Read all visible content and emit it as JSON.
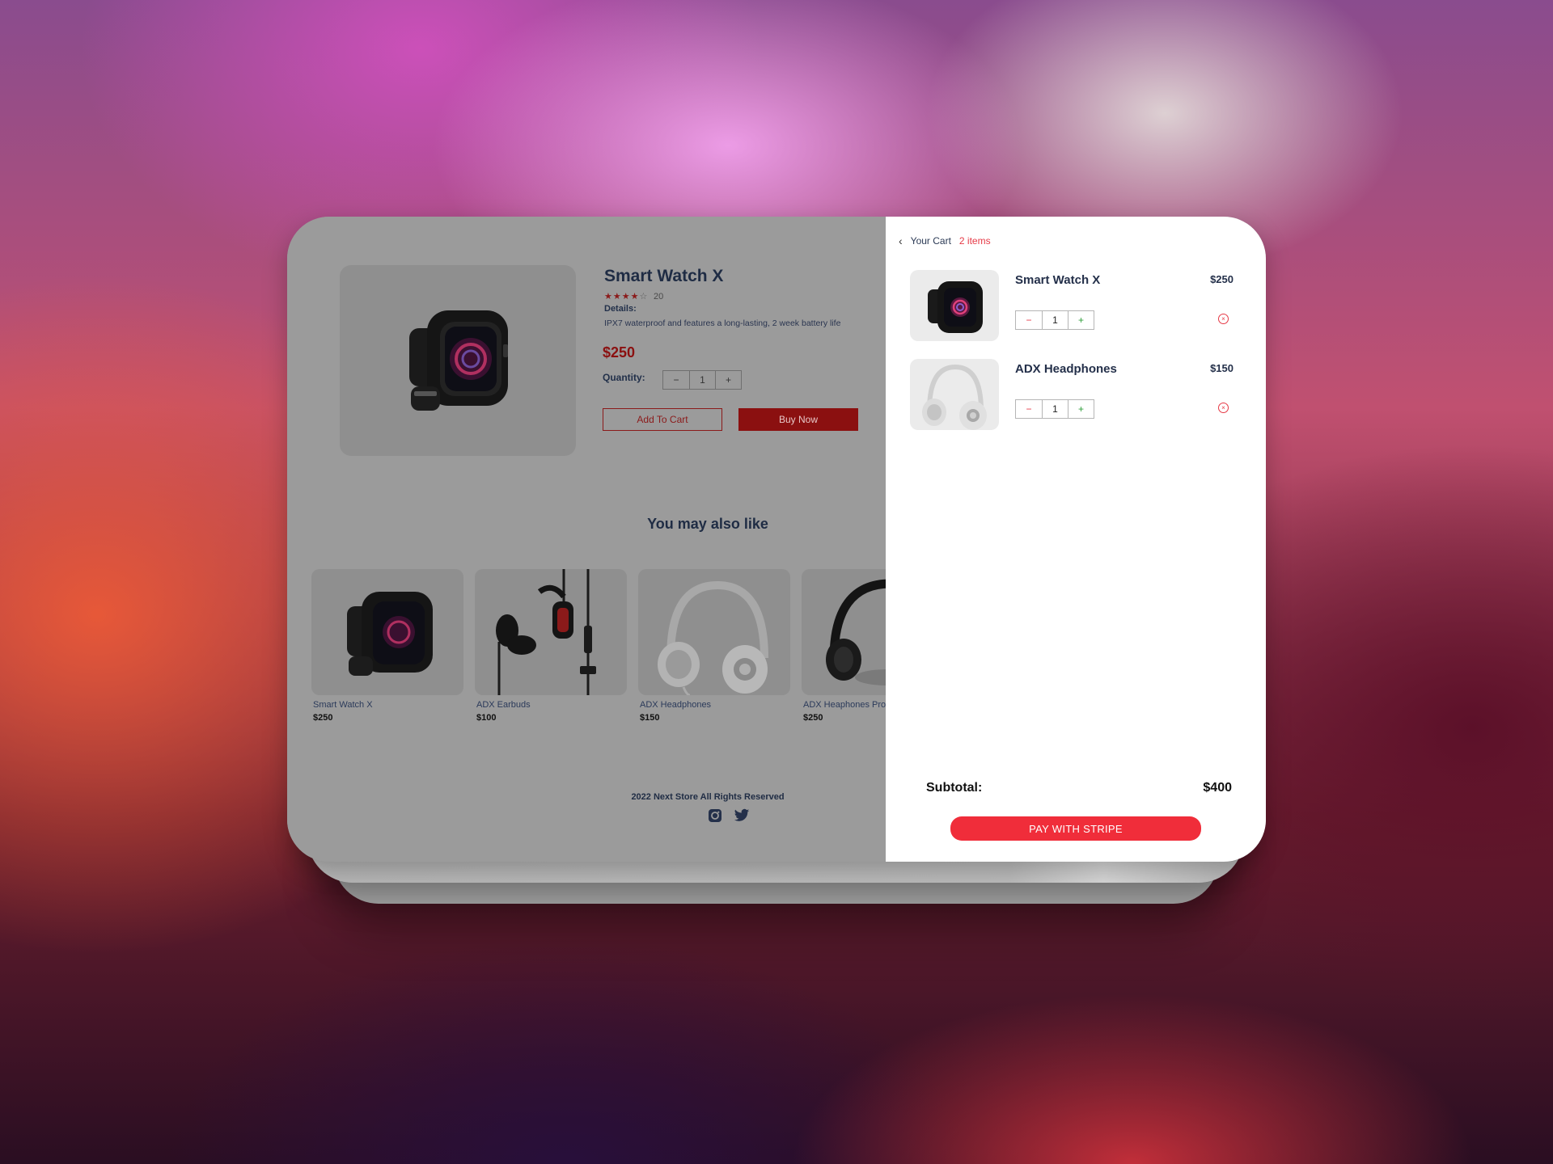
{
  "product": {
    "title": "Smart Watch X",
    "stars_filled": "★★★★",
    "stars_empty": "☆",
    "review_count": "20",
    "details_label": "Details:",
    "details_text": "IPX7 waterproof and features a long-lasting, 2 week battery life",
    "price": "$250",
    "quantity_label": "Quantity:",
    "quantity": "1",
    "add_to_cart_label": "Add To Cart",
    "buy_now_label": "Buy Now"
  },
  "recommendations": {
    "heading": "You may also like",
    "items": [
      {
        "name": "Smart Watch X",
        "price": "$250",
        "image": "watch"
      },
      {
        "name": "ADX Earbuds",
        "price": "$100",
        "image": "earbuds"
      },
      {
        "name": "ADX Headphones",
        "price": "$150",
        "image": "headphones-white"
      },
      {
        "name": "ADX Heaphones Pro",
        "price": "$250",
        "image": "headphones-black"
      }
    ]
  },
  "footer": {
    "text": "2022 Next Store All Rights Reserved",
    "icons": [
      "instagram-icon",
      "twitter-icon"
    ]
  },
  "cart": {
    "title": "Your Cart",
    "item_count": "2 items",
    "items": [
      {
        "name": "Smart Watch X",
        "price": "$250",
        "quantity": "1",
        "image": "watch"
      },
      {
        "name": "ADX Headphones",
        "price": "$150",
        "quantity": "1",
        "image": "headphones-white"
      }
    ],
    "subtotal_label": "Subtotal:",
    "subtotal_value": "$400",
    "pay_button_label": "PAY WITH STRIPE"
  },
  "colors": {
    "accent": "#f02d3a",
    "accent_dimmed": "#8b1010",
    "text_dark": "#24304a",
    "plus_green": "#2e9e3a"
  }
}
